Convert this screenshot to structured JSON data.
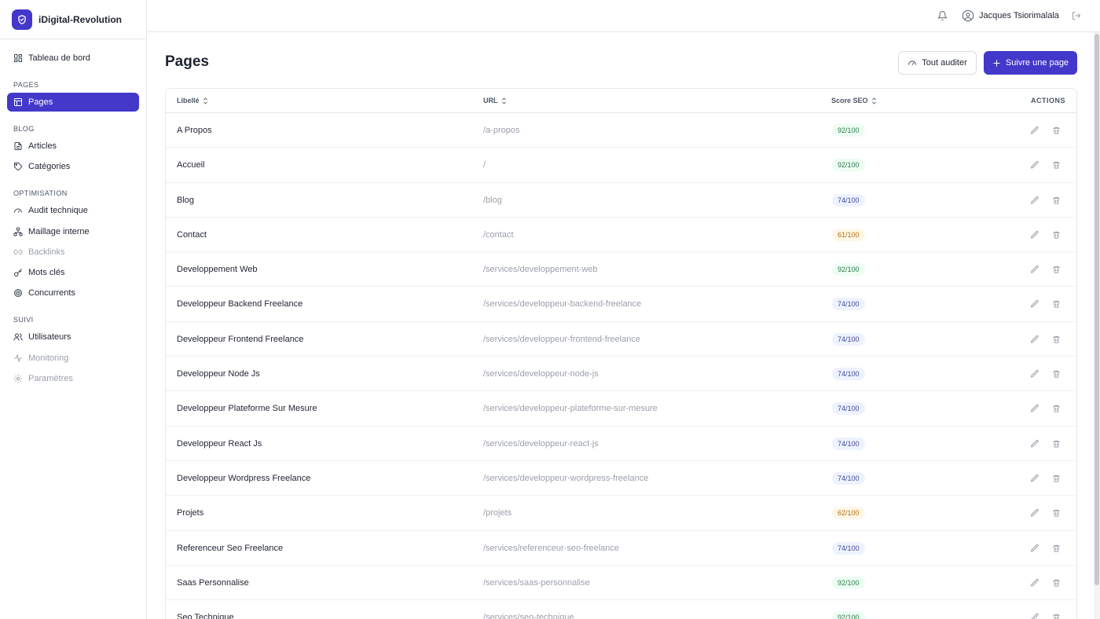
{
  "brand": {
    "name": "iDigital-Revolution"
  },
  "sidebar": {
    "dashboard": "Tableau de bord",
    "sections": {
      "pages": "PAGES",
      "blog": "BLOG",
      "optimisation": "OPTIMISATION",
      "suivi": "SUIVI"
    },
    "items": {
      "pages": "Pages",
      "articles": "Articles",
      "categories": "Catégories",
      "audit": "Audit technique",
      "maillage": "Maillage interne",
      "backlinks": "Backlinks",
      "mots_cles": "Mots clés",
      "concurrents": "Concurrents",
      "utilisateurs": "Utilisateurs",
      "monitoring": "Monitoring",
      "parametres": "Paramètres"
    }
  },
  "header": {
    "user_name": "Jacques Tsiorimalala"
  },
  "main": {
    "title": "Pages",
    "audit_all_label": "Tout auditer",
    "follow_page_label": "Suivre une page"
  },
  "table": {
    "columns": {
      "label": "Libellé",
      "url": "URL",
      "score": "Score SEO",
      "actions": "ACTIONS"
    },
    "rows": [
      {
        "label": "A Propos",
        "url": "/a-propos",
        "score": "92/100",
        "level": "green"
      },
      {
        "label": "Accueil",
        "url": "/",
        "score": "92/100",
        "level": "green"
      },
      {
        "label": "Blog",
        "url": "/blog",
        "score": "74/100",
        "level": "blue"
      },
      {
        "label": "Contact",
        "url": "/contact",
        "score": "61/100",
        "level": "orange"
      },
      {
        "label": "Developpement Web",
        "url": "/services/developpement-web",
        "score": "92/100",
        "level": "green"
      },
      {
        "label": "Developpeur Backend Freelance",
        "url": "/services/developpeur-backend-freelance",
        "score": "74/100",
        "level": "blue"
      },
      {
        "label": "Developpeur Frontend Freelance",
        "url": "/services/developpeur-frontend-freelance",
        "score": "74/100",
        "level": "blue"
      },
      {
        "label": "Developpeur Node Js",
        "url": "/services/developpeur-node-js",
        "score": "74/100",
        "level": "blue"
      },
      {
        "label": "Developpeur Plateforme Sur Mesure",
        "url": "/services/developpeur-plateforme-sur-mesure",
        "score": "74/100",
        "level": "blue"
      },
      {
        "label": "Developpeur React Js",
        "url": "/services/developpeur-react-js",
        "score": "74/100",
        "level": "blue"
      },
      {
        "label": "Developpeur Wordpress Freelance",
        "url": "/services/developpeur-wordpress-freelance",
        "score": "74/100",
        "level": "blue"
      },
      {
        "label": "Projets",
        "url": "/projets",
        "score": "62/100",
        "level": "orange"
      },
      {
        "label": "Referenceur Seo Freelance",
        "url": "/services/referenceur-seo-freelance",
        "score": "74/100",
        "level": "blue"
      },
      {
        "label": "Saas Personnalise",
        "url": "/services/saas-personnalise",
        "score": "92/100",
        "level": "green"
      },
      {
        "label": "Seo Technique",
        "url": "/services/seo-technique",
        "score": "92/100",
        "level": "green"
      }
    ]
  },
  "colors": {
    "accent": "#4338ca",
    "good": "#2f7a4d",
    "medium": "#3f4a8f",
    "warn": "#b36b14"
  }
}
